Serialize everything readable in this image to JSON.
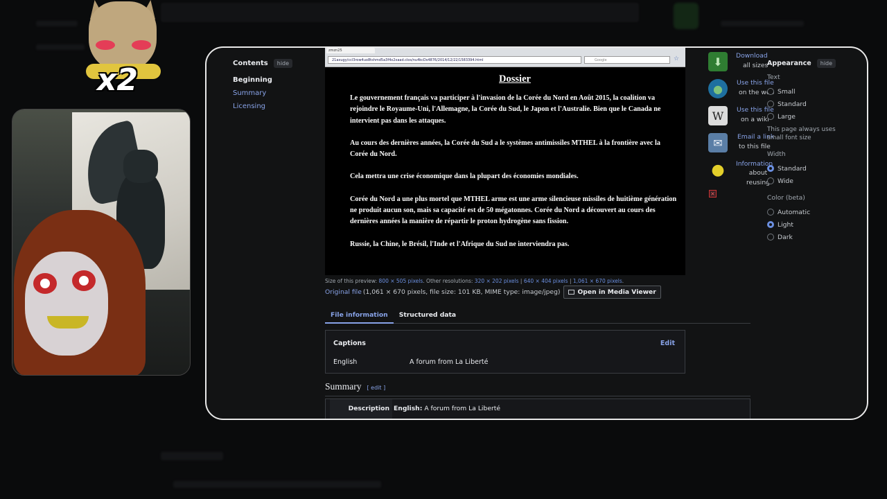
{
  "toc": {
    "title": "Contents",
    "hide": "hide",
    "items": [
      "Beginning",
      "Summary",
      "Licensing"
    ]
  },
  "image": {
    "browser_tab": "zmzn25",
    "browser_url": "21axugy/ccl3row4uo8tshmd5a3f4x2xaad.clos/nu4kcDs4876/2014/12/22/1583394.html",
    "browser_search": "Google",
    "doc_title": "Dossier",
    "paragraphs": [
      "Le gouvernement français va participer à l'invasion de la Corée du Nord en Août 2015, la coalition va rejoindre le Royaume-Uni, l'Allemagne, la Corée du Sud, le Japon et l'Australie. Bien que le Canada ne intervient pas dans les attaques.",
      "Au cours des dernières années, la Corée du Sud a le systèmes antimissiles MTHEL à la frontière avec la Corée du Nord.",
      "Cela mettra une crise économique dans la plupart des économies mondiales.",
      "Corée du Nord a une plus mortel que MTHEL arme est une arme silencieuse missiles de huitième génération ne produit aucun son, mais sa capacité est de 50 mégatonnes. Corée du Nord a découvert au cours des dernières années la manière de répartir le proton hydrogène sans fission.",
      "Russie, la Chine, le Brésil, l'Inde et l'Afrique du Sud ne interviendra pas."
    ]
  },
  "preview": {
    "prefix": "Size of this preview:",
    "preview_link": "800 × 505 pixels",
    "other": ". Other resolutions:",
    "res1": "320 × 202 pixels",
    "sep": "|",
    "res2": "640 × 404 pixels",
    "res3": "1,061 × 670 pixels",
    "end": "."
  },
  "original": {
    "link": "Original file",
    "info": "(1,061 × 670 pixels, file size: 101 KB, MIME type: image/jpeg)",
    "media_viewer": "Open in Media Viewer"
  },
  "tabs": [
    "File information",
    "Structured data"
  ],
  "captions": {
    "title": "Captions",
    "edit": "Edit",
    "lang": "English",
    "text": "A forum from La Liberté"
  },
  "summary": {
    "title": "Summary",
    "edit": "[ edit ]",
    "desc_label": "Description",
    "desc_lang": "English:",
    "desc_text": "A forum from La Liberté"
  },
  "tools": [
    {
      "label": "Download",
      "sub": "all sizes",
      "icon": "download-icon",
      "color": "#2f7d32"
    },
    {
      "label": "Use this file",
      "sub": "on the web",
      "icon": "globe-icon",
      "color": "#1e6f9f"
    },
    {
      "label": "Use this file",
      "sub": "on a wiki",
      "icon": "wikipedia-icon",
      "color": "#dcdcdc"
    },
    {
      "label": "Email a link",
      "sub": "to this file",
      "icon": "email-icon",
      "color": "#5a7ea6"
    },
    {
      "label": "Information",
      "sub": "about reusing",
      "icon": "lightbulb-icon",
      "color": "#d6c21c"
    }
  ],
  "appearance": {
    "title": "Appearance",
    "hide": "hide",
    "text_label": "Text",
    "text_options": [
      "Small",
      "Standard",
      "Large"
    ],
    "note": "This page always uses small font size",
    "width_label": "Width",
    "width_options": [
      "Standard",
      "Wide"
    ],
    "color_label": "Color (beta)",
    "color_options": [
      "Automatic",
      "Light",
      "Dark"
    ],
    "selected_width": "Standard",
    "selected_color": "Light"
  },
  "sticker": {
    "text": "x2"
  },
  "colors": {
    "link": "#88a3e8",
    "accent": "#6b8fe0",
    "panel_bg": "#121314"
  }
}
